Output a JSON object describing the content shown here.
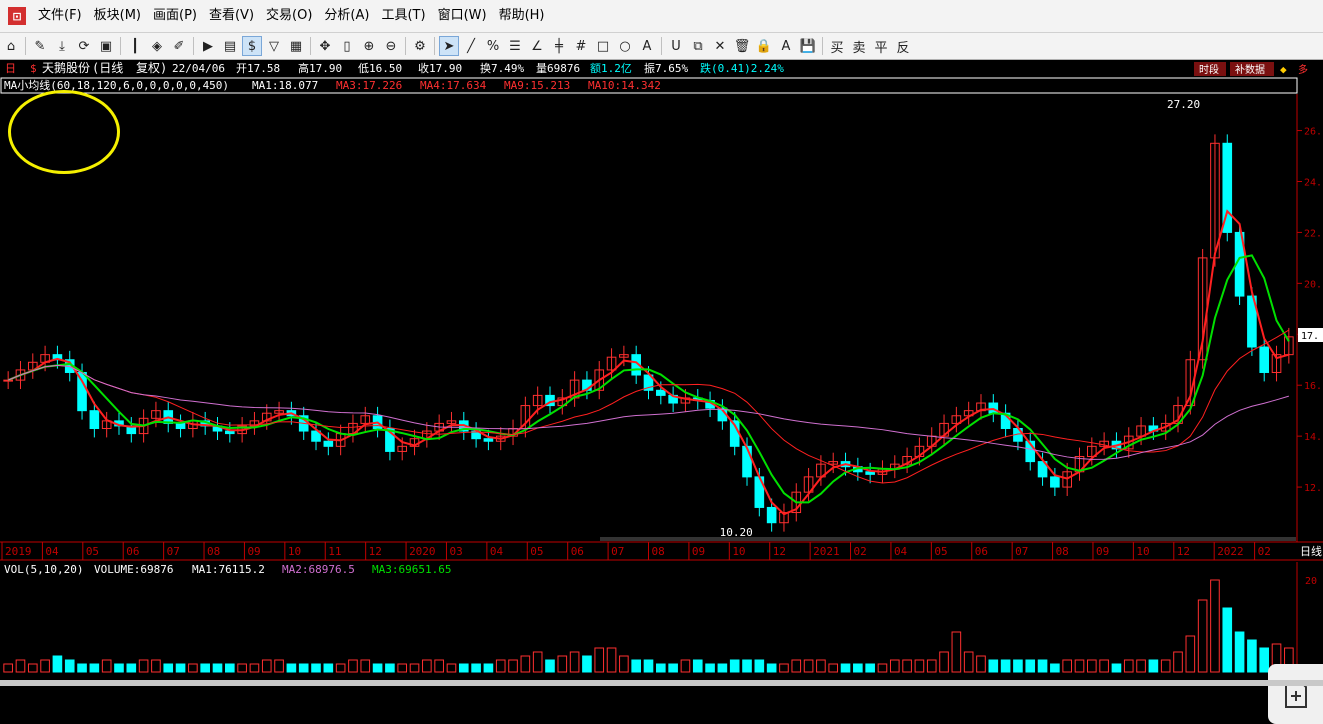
{
  "menu": {
    "items": [
      "文件(F)",
      "板块(M)",
      "画面(P)",
      "查看(V)",
      "交易(O)",
      "分析(A)",
      "工具(T)",
      "窗口(W)",
      "帮助(H)"
    ]
  },
  "toolbar": {
    "currency_symbol": "$",
    "trade_labels": [
      "买",
      "卖",
      "平",
      "反"
    ]
  },
  "header": {
    "badge": "日",
    "stock_name": "天鹅股份",
    "period": "(日线",
    "adjust": "复权)",
    "date": "22/04/06",
    "open": "开17.58",
    "high": "高17.90",
    "low": "低16.50",
    "close": "收17.90",
    "turnover": "换7.49%",
    "volume": "量69876",
    "amount": "额1.2亿",
    "amplitude": "振7.65%",
    "change": "跌(0.41)2.24%",
    "btn_time": "时段",
    "btn_fill": "补数据"
  },
  "ma_line": {
    "name": "MA小均线(60,18,120,6,0,0,0,0,0,450)",
    "ma1": "MA1:18.077",
    "ma3": "MA3:17.226",
    "ma4": "MA4:17.634",
    "ma9": "MA9:15.213",
    "ma10": "MA10:14.342"
  },
  "vol_line": {
    "name": "VOL(5,10,20)",
    "volume": "VOLUME:69876",
    "ma1": "MA1:76115.2",
    "ma2": "MA2:68976.5",
    "ma3": "MA3:69651.65"
  },
  "colors": {
    "up": "#ff3030",
    "down": "#00ffff",
    "ma_green": "#00e000",
    "ma_red": "#ff2020",
    "ma_purple": "#d070d0",
    "axis": "#c00000",
    "yellow": "#ffff00"
  },
  "chart_data": {
    "type": "candlestick",
    "price_yticks": [
      12,
      14,
      16,
      18,
      20,
      22,
      24,
      26
    ],
    "price_yticks_labels": [
      "12.",
      "14.",
      "16.",
      "18.",
      "20.",
      "22.",
      "24.",
      "26."
    ],
    "current_price_label": "17.",
    "ylim": [
      10.0,
      27.2
    ],
    "max_label": "27.20",
    "min_label": "10.20",
    "x_labels": [
      "2019",
      "04",
      "05",
      "06",
      "07",
      "08",
      "09",
      "10",
      "11",
      "12",
      "2020",
      "03",
      "04",
      "05",
      "06",
      "07",
      "08",
      "09",
      "10",
      "12",
      "2021",
      "02",
      "04",
      "05",
      "06",
      "07",
      "08",
      "09",
      "10",
      "12",
      "2022",
      "02"
    ],
    "x_label_right": "日线",
    "close_series": [
      16.2,
      16.6,
      16.9,
      17.2,
      17.0,
      16.5,
      15.0,
      14.3,
      14.6,
      14.4,
      14.1,
      14.7,
      15.0,
      14.5,
      14.3,
      14.6,
      14.4,
      14.2,
      14.1,
      14.4,
      14.6,
      14.9,
      15.0,
      14.8,
      14.2,
      13.8,
      13.6,
      14.1,
      14.5,
      14.8,
      14.3,
      13.4,
      13.6,
      13.9,
      14.2,
      14.5,
      14.6,
      14.2,
      13.9,
      13.8,
      14.0,
      14.3,
      15.2,
      15.6,
      15.2,
      15.5,
      16.2,
      15.8,
      16.6,
      17.1,
      17.2,
      16.4,
      15.8,
      15.6,
      15.3,
      15.5,
      15.4,
      15.1,
      14.6,
      13.6,
      12.4,
      11.2,
      10.6,
      11.0,
      11.8,
      12.4,
      12.9,
      13.0,
      12.8,
      12.6,
      12.5,
      12.7,
      12.9,
      13.2,
      13.6,
      14.0,
      14.5,
      14.8,
      15.0,
      15.3,
      14.9,
      14.3,
      13.8,
      13.0,
      12.4,
      12.0,
      12.6,
      13.2,
      13.6,
      13.8,
      13.5,
      14.0,
      14.4,
      14.2,
      14.5,
      15.2,
      17.0,
      21.0,
      25.5,
      22.0,
      19.5,
      17.5,
      16.5,
      17.2,
      17.9
    ],
    "volume_series": [
      2,
      3,
      2,
      3,
      4,
      3,
      2,
      2,
      3,
      2,
      2,
      3,
      3,
      2,
      2,
      2,
      2,
      2,
      2,
      2,
      2,
      3,
      3,
      2,
      2,
      2,
      2,
      2,
      3,
      3,
      2,
      2,
      2,
      2,
      3,
      3,
      2,
      2,
      2,
      2,
      3,
      3,
      4,
      5,
      3,
      4,
      5,
      4,
      6,
      6,
      4,
      3,
      3,
      2,
      2,
      3,
      3,
      2,
      2,
      3,
      3,
      3,
      2,
      2,
      3,
      3,
      3,
      2,
      2,
      2,
      2,
      2,
      3,
      3,
      3,
      3,
      5,
      10,
      5,
      4,
      3,
      3,
      3,
      3,
      3,
      2,
      3,
      3,
      3,
      3,
      2,
      3,
      3,
      3,
      3,
      5,
      9,
      18,
      23,
      16,
      10,
      8,
      6,
      7,
      6
    ],
    "vol_yticks_labels": [
      "20"
    ]
  }
}
